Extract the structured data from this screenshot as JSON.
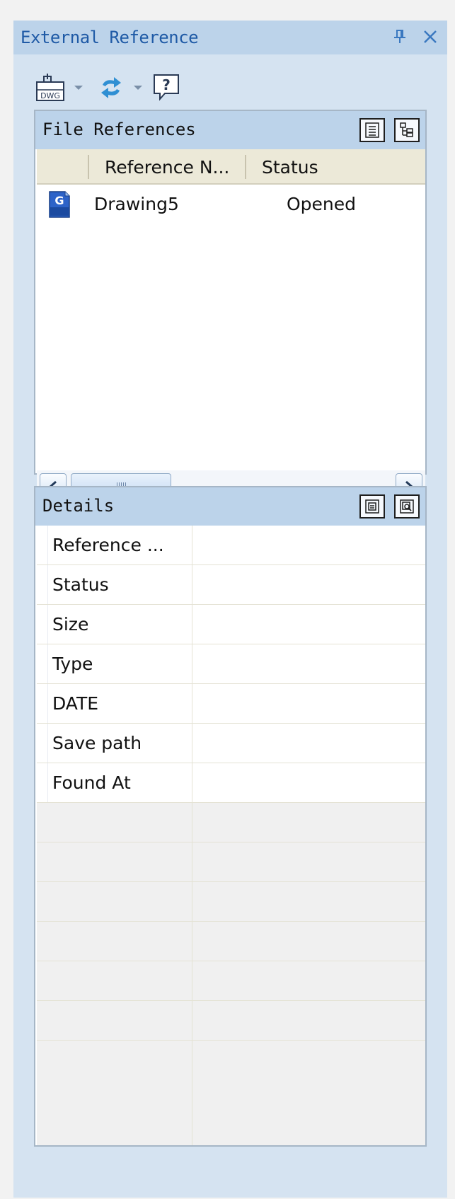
{
  "panel": {
    "title": "External Reference"
  },
  "toolbar": {
    "attach_icon": "attach-dwg-icon",
    "attach_icon_text": "DWG",
    "refresh_icon": "refresh-icon",
    "help_icon": "help-icon",
    "help_glyph": "?"
  },
  "file_references": {
    "title": "File References",
    "view_buttons": [
      "list-view-icon",
      "tree-view-icon"
    ],
    "columns": [
      "Reference N...",
      "Status"
    ],
    "rows": [
      {
        "icon": "dwg-file-icon",
        "name": "Drawing5",
        "status": "Opened"
      }
    ]
  },
  "details": {
    "title": "Details",
    "view_buttons": [
      "details-view-icon",
      "preview-icon"
    ],
    "properties": [
      {
        "key": "Reference ...",
        "value": ""
      },
      {
        "key": "Status",
        "value": ""
      },
      {
        "key": "Size",
        "value": ""
      },
      {
        "key": "Type",
        "value": ""
      },
      {
        "key": "DATE",
        "value": ""
      },
      {
        "key": "Save path",
        "value": ""
      },
      {
        "key": "Found At",
        "value": ""
      }
    ],
    "empty_rows": 7
  },
  "colors": {
    "panel_bg": "#d5e3f1",
    "header_bg": "#bcd3ea",
    "title_text": "#1f5aa6",
    "empty_row_bg": "#f0f0f0"
  }
}
